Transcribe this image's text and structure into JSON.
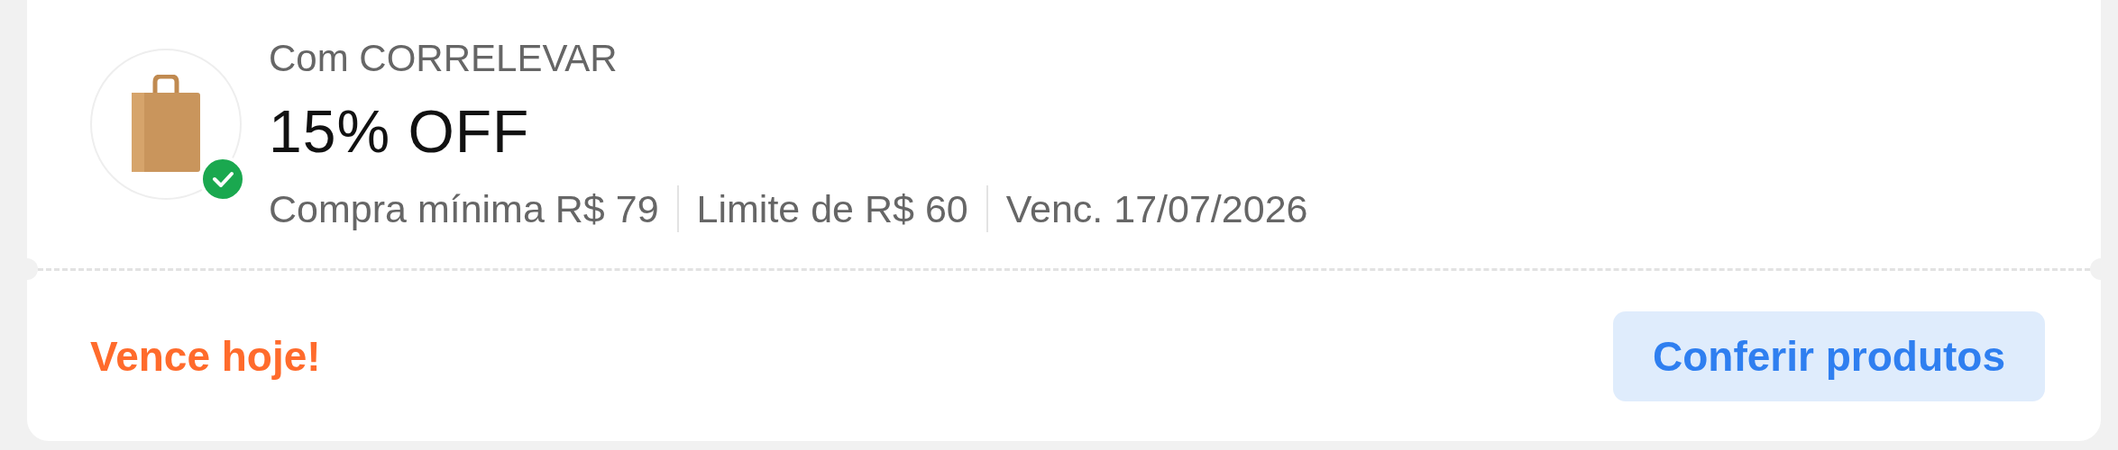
{
  "coupon": {
    "subtitle": "Com CORRELEVAR",
    "title": "15% OFF",
    "details": [
      "Compra mínima R$ 79",
      "Limite de R$ 60",
      "Venc. 17/07/2026"
    ],
    "applied": true,
    "expiry_notice": "Vence hoje!",
    "action": "Conferir produtos"
  }
}
